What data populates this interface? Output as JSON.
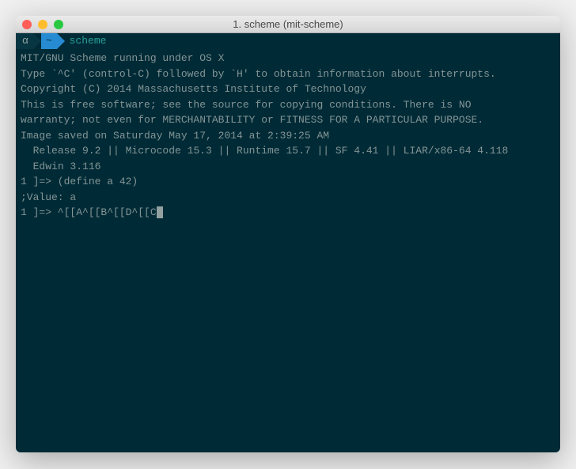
{
  "window": {
    "title": "1. scheme (mit-scheme)"
  },
  "prompt": {
    "seg1": "α",
    "seg2": "~",
    "command": "scheme"
  },
  "lines": {
    "l1": "MIT/GNU Scheme running under OS X",
    "l2": "Type `^C' (control-C) followed by `H' to obtain information about interrupts.",
    "l3": "",
    "l4": "Copyright (C) 2014 Massachusetts Institute of Technology",
    "l5": "This is free software; see the source for copying conditions. There is NO",
    "l6": "warranty; not even for MERCHANTABILITY or FITNESS FOR A PARTICULAR PURPOSE.",
    "l7": "",
    "l8": "Image saved on Saturday May 17, 2014 at 2:39:25 AM",
    "l9": "  Release 9.2 || Microcode 15.3 || Runtime 15.7 || SF 4.41 || LIAR/x86-64 4.118",
    "l10": "  Edwin 3.116",
    "l11": "",
    "l12": "1 ]=> (define a 42)",
    "l13": "",
    "l14": ";Value: a",
    "l15": "",
    "l16": "1 ]=> ^[[A^[[B^[[D^[[C"
  }
}
